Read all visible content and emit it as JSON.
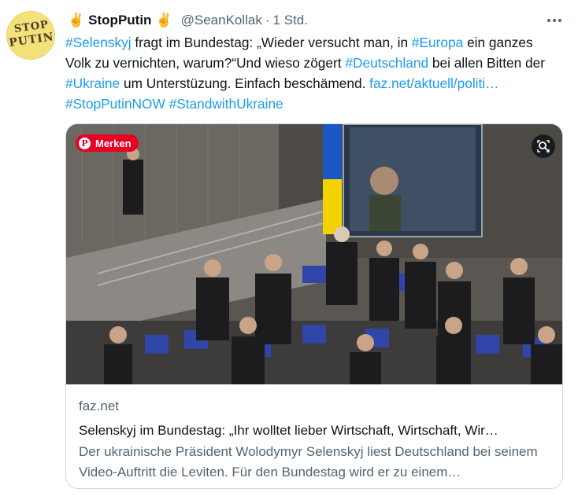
{
  "author": {
    "avatar_text_line1": "STOP",
    "avatar_text_line2": "PUTIN",
    "emoji_left": "✌️",
    "display_name": "StopPutin",
    "emoji_right": "✌️",
    "handle": "@SeanKollak",
    "separator": "·",
    "time": "1 Std."
  },
  "tweet": {
    "segments": [
      {
        "text": "#Selenskyj",
        "kind": "tag"
      },
      {
        "text": " fragt im Bundestag: „Wieder versucht man, in ",
        "kind": "plain"
      },
      {
        "text": "#Europa",
        "kind": "tag"
      },
      {
        "text": " ein ganzes Volk zu vernichten, warum?“Und wieso zögert ",
        "kind": "plain"
      },
      {
        "text": "#Deutschland",
        "kind": "tag"
      },
      {
        "text": " bei allen Bitten der ",
        "kind": "plain"
      },
      {
        "text": "#Ukraine",
        "kind": "tag"
      },
      {
        "text": " um Unterstüzung. Einfach beschämend. ",
        "kind": "plain"
      },
      {
        "text": "faz.net/aktuell/politi…",
        "kind": "link"
      },
      {
        "text": " ",
        "kind": "plain"
      },
      {
        "text": "#StopPutinNOW",
        "kind": "tag"
      },
      {
        "text": " ",
        "kind": "plain"
      },
      {
        "text": "#StandwithUkraine",
        "kind": "tag"
      }
    ]
  },
  "card": {
    "merken_label": "Merken",
    "domain": "faz.net",
    "title": "Selenskyj im Bundestag: „Ihr wolltet lieber Wirtschaft, Wirtschaft, Wir…",
    "description": "Der ukrainische Präsident Wolodymyr Selenskyj liest Deutschland bei seinem Video-Auftritt die Leviten. Für den Bundestag wird er zu einem…"
  },
  "colors": {
    "link": "#1d9bf0",
    "text": "#0f1419",
    "secondary": "#536471",
    "border": "#cfd9de",
    "pinterest": "#e60023"
  },
  "icons": [
    "victory-hand-icon",
    "more-options-icon",
    "pinterest-icon",
    "visual-search-icon"
  ]
}
